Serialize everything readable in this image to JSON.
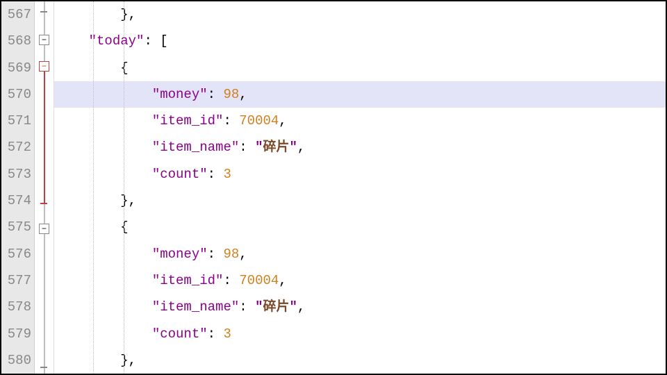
{
  "lineNumbers": [
    "567",
    "568",
    "569",
    "570",
    "571",
    "572",
    "573",
    "574",
    "575",
    "576",
    "577",
    "578",
    "579",
    "580"
  ],
  "code": {
    "l0": "},",
    "todayKey": "\"today\"",
    "todayAfter": ": [",
    "openBrace": "{",
    "closeBraceComma": "},",
    "moneyKey": "\"money\"",
    "moneyVal1": "98",
    "itemIdKey": "\"item_id\"",
    "itemIdVal1": "70004",
    "itemNameKey": "\"item_name\"",
    "itemNameVal1": "碎片",
    "countKey": "\"count\"",
    "countVal1": "3",
    "moneyVal2": "98",
    "itemIdVal2": "70004",
    "itemNameVal2": "碎片",
    "countVal2": "3",
    "colon": ": ",
    "comma": ",",
    "quote": "\""
  }
}
